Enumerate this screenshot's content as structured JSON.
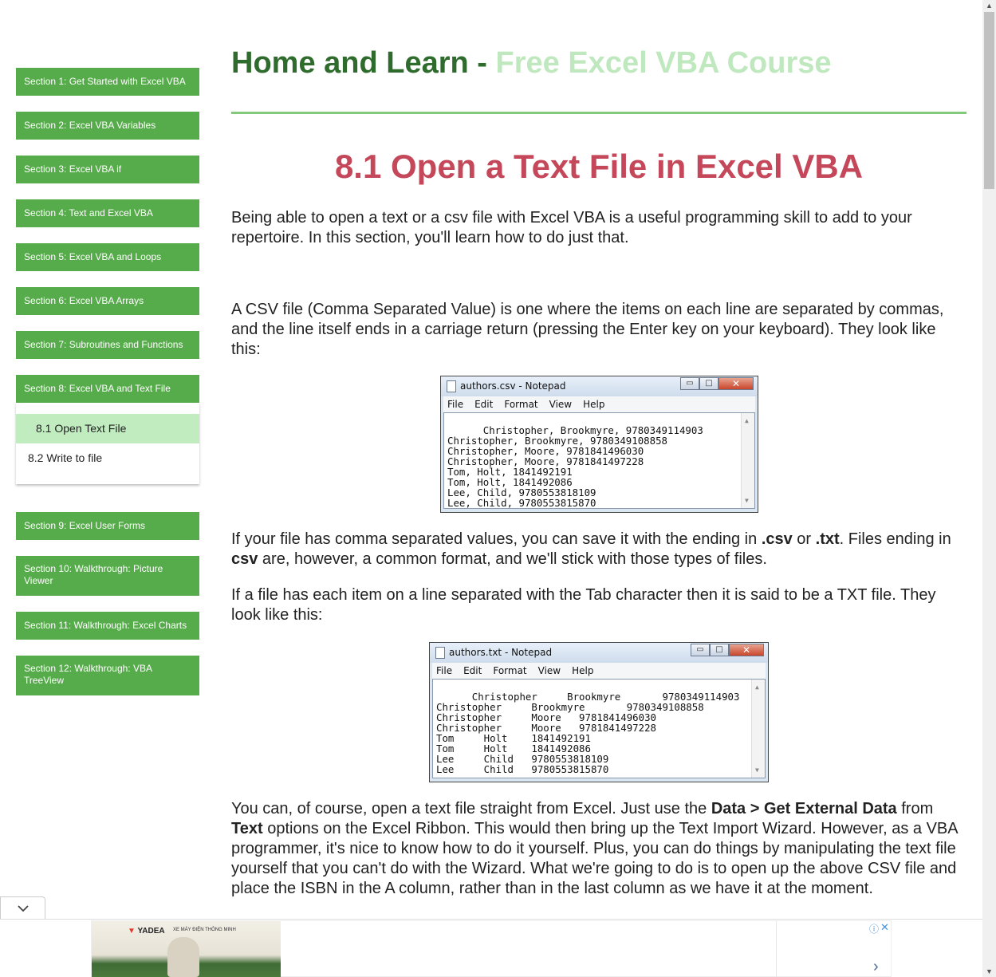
{
  "sidebar": {
    "sections": [
      {
        "label": "Section 1: Get Started with Excel VBA"
      },
      {
        "label": "Section 2: Excel VBA Variables"
      },
      {
        "label": "Section 3: Excel VBA if"
      },
      {
        "label": "Section 4: Text and Excel VBA"
      },
      {
        "label": "Section 5: Excel VBA and Loops"
      },
      {
        "label": "Section 6: Excel VBA Arrays"
      },
      {
        "label": "Section 7: Subroutines and Functions"
      },
      {
        "label": "Section 8: Excel VBA and Text File"
      },
      {
        "label": "Section 9: Excel User Forms"
      },
      {
        "label": "Section 10: Walkthrough: Picture Viewer"
      },
      {
        "label": "Section 11: Walkthrough: Excel Charts"
      },
      {
        "label": "Section 12: Walkthrough: VBA TreeView"
      }
    ],
    "subitems": [
      {
        "label": "8.1 Open Text File",
        "active": true
      },
      {
        "label": "8.2 Write to file",
        "active": false
      }
    ]
  },
  "header": {
    "site_name": "Home and Learn",
    "separator": " - ",
    "tagline": "Free Excel VBA Course"
  },
  "main": {
    "title": "8.1 Open a Text File in Excel VBA",
    "intro": "Being able to open a text or a csv file with Excel VBA is a useful programming skill to add to your repertoire. In this section, you'll learn how to do just that.",
    "csv_para": "A CSV file (Comma Separated Value) is one where the items on each line are separated by commas, and the line itself ends in a carriage return (pressing the Enter key on your keyboard). They look like this:",
    "para3": {
      "a": "If your file has comma separated values, you can save it with the ending in ",
      "b": ".csv",
      "c": " or ",
      "d": ".txt",
      "e": ". Files ending in ",
      "f": "csv",
      "g": " are, however, a common format, and we'll stick with those types of files."
    },
    "txt_para": "If a file has each item on a line separated with the Tab character then it is said to be a TXT file. They look like this:",
    "para5": {
      "a": "You can, of course, open a text file straight from Excel. Just use the ",
      "b": "Data > Get External Data",
      "c": " from ",
      "d": "Text",
      "e": " options on the Excel Ribbon. This would then bring up the Text Import Wizard. However, as a VBA programmer, it's nice to know how to do it yourself. Plus, you can do things by manipulating the text file yourself that you can't do with the Wizard. What we're going to do is to open up the above CSV file and place the ISBN in the A column, rather than in the last column as we have it at the moment."
    }
  },
  "notepad_menu": [
    "File",
    "Edit",
    "Format",
    "View",
    "Help"
  ],
  "csv_window": {
    "title": "authors.csv - Notepad",
    "content": "Christopher, Brookmyre, 9780349114903\nChristopher, Brookmyre, 9780349108858\nChristopher, Moore, 9781841496030\nChristopher, Moore, 9781841497228\nTom, Holt, 1841492191\nTom, Holt, 1841492086\nLee, Child, 9780553818109\nLee, Child, 9780553815870"
  },
  "txt_window": {
    "title": "authors.txt - Notepad",
    "content": "Christopher     Brookmyre       9780349114903\nChristopher     Brookmyre       9780349108858\nChristopher     Moore   9781841496030\nChristopher     Moore   9781841497228\nTom     Holt    1841492191\nTom     Holt    1841492086\nLee     Child   9780553818109\nLee     Child   9780553815870"
  },
  "ad": {
    "brand": "YADEA",
    "subtitle": "XE MÁY ĐIỆN THÔNG MINH"
  },
  "colors": {
    "sidebar_green": "#56ac4a",
    "active_sub": "#c1ecc0",
    "title_red": "#c4485a",
    "site_dark_green": "#2e6b2d",
    "site_light_green": "#bfe8be",
    "rule_green": "#82c97c"
  },
  "icons": {
    "collapse": "chevron-down-icon",
    "ad_info": "info-icon",
    "ad_close": "close-icon",
    "ad_next": "chevron-right-icon"
  }
}
